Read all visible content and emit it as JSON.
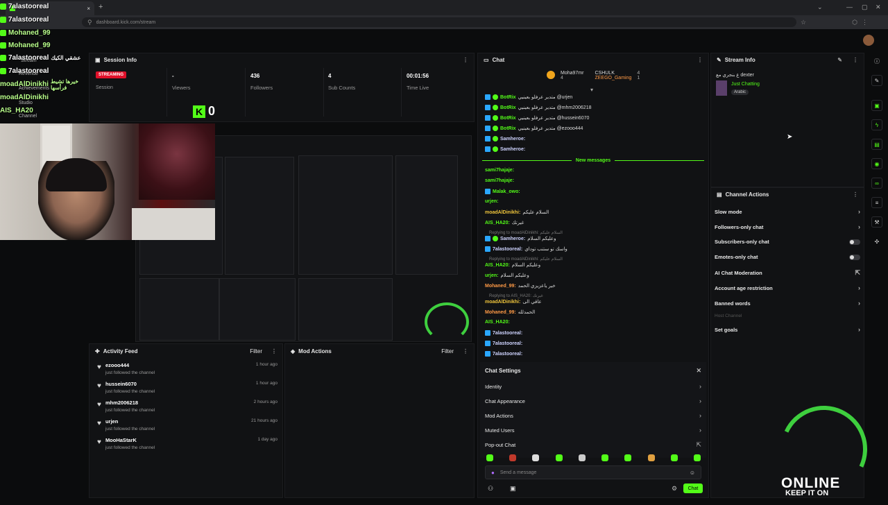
{
  "browser": {
    "url": "dashboard.kick.com/stream",
    "tab_close": "×",
    "new_tab": "+"
  },
  "overlay_chat": [
    {
      "name": "7alastooreal",
      "text": ""
    },
    {
      "name": "7alastooreal",
      "text": ""
    },
    {
      "name": "Mohaned_99",
      "text": ""
    },
    {
      "name": "Mohaned_99",
      "text": ""
    },
    {
      "name": "7alastooreal",
      "text": "عشقي الكيك"
    },
    {
      "name": "7alastooreal",
      "text": ""
    },
    {
      "name": "moadAlDinikhi",
      "text": "خيرها تشيط فرأسها"
    },
    {
      "name": "moadAlDinikhi",
      "text": ""
    },
    {
      "name": "AIS_HA20",
      "text": ""
    }
  ],
  "overlay_labels": [
    "Stream",
    "Revenue",
    "Achievements",
    "Studio",
    "Channel"
  ],
  "session": {
    "title": "Session Info",
    "badge": "STREAMING",
    "session_label": "Session",
    "stats": [
      {
        "value": "-",
        "label": "Viewers"
      },
      {
        "value": "436",
        "label": "Followers"
      },
      {
        "value": "4",
        "label": "Sub Counts"
      },
      {
        "value": "00:01:56",
        "label": "Time Live"
      }
    ],
    "kick_count": "0"
  },
  "activity": {
    "title": "Activity Feed",
    "filter": "Filter",
    "items": [
      {
        "name": "ezooo444",
        "sub": "just followed the channel",
        "time": "1 hour ago"
      },
      {
        "name": "hussein6070",
        "sub": "just followed the channel",
        "time": "1 hour ago"
      },
      {
        "name": "mhm2006218",
        "sub": "just followed the channel",
        "time": "2 hours ago"
      },
      {
        "name": "urjen",
        "sub": "just followed the channel",
        "time": "21 hours ago"
      },
      {
        "name": "MooHaStarK",
        "sub": "just followed the channel",
        "time": "1 day ago"
      }
    ]
  },
  "mod_actions": {
    "title": "Mod Actions",
    "filter": "Filter"
  },
  "chat": {
    "title": "Chat",
    "top_gifters": [
      {
        "name": "Moha97mr",
        "count": "4"
      },
      {
        "name": "CSHULK",
        "count": "4"
      },
      {
        "name": "ZEEGO_Gaming",
        "count": "1"
      }
    ],
    "new_messages": "New messages",
    "messages": [
      {
        "user": "BotRix",
        "text": "متدير عرفلو بعينيي @urjen",
        "cls": ""
      },
      {
        "user": "BotRix",
        "text": "متدير عرفلو بعينيي @mhm2006218",
        "cls": ""
      },
      {
        "user": "BotRix",
        "text": "متدير عرفلو بعينيي @hussein6070",
        "cls": ""
      },
      {
        "user": "BotRix",
        "text": "متدير عرفلو بعينيي @ezooo444",
        "cls": ""
      },
      {
        "user": "Samheroe:",
        "text": "",
        "cls": "w"
      },
      {
        "user": "Samheroe:",
        "text": "",
        "cls": "w"
      },
      {
        "user": "sami7hajaje:",
        "text": "",
        "cls": ""
      },
      {
        "user": "sami7hajaje:",
        "text": "",
        "cls": ""
      },
      {
        "user": "Malak_owo:",
        "text": "",
        "cls": ""
      },
      {
        "user": "urjen:",
        "text": "",
        "cls": ""
      },
      {
        "user": "moadAlDinikhi:",
        "text": "السلام عليكم",
        "cls": "y"
      },
      {
        "user": "AIS_HA20:",
        "text": "غيرتك",
        "cls": ""
      },
      {
        "user": "Samheroe:",
        "text": "وعليكم السلام",
        "cls": "w"
      },
      {
        "user": "7alastooreal:",
        "text": "واسك تو ستنب توداي",
        "cls": "w"
      },
      {
        "user": "AIS_HA20:",
        "text": "وعليكم السلام",
        "cls": ""
      },
      {
        "user": "urjen:",
        "text": "وعليكم السلام",
        "cls": ""
      },
      {
        "user": "Mohaned_99:",
        "text": "خير ياعزيزي الحمد",
        "cls": "o"
      },
      {
        "user": "moadAlDinikhi:",
        "text": "عاقي الى",
        "cls": "y"
      },
      {
        "user": "Mohaned_99:",
        "text": "الحمدلله",
        "cls": "o"
      },
      {
        "user": "AIS_HA20:",
        "text": "",
        "cls": ""
      },
      {
        "user": "7alastooreal:",
        "text": "",
        "cls": "w"
      },
      {
        "user": "7alastooreal:",
        "text": "",
        "cls": "w"
      },
      {
        "user": "7alastooreal:",
        "text": "",
        "cls": "w"
      }
    ],
    "replies": [
      "Replying to moadAlDinikhi: السلام عليكم",
      "Replying to moadAlDinikhi: السلام عليكم",
      "Replying to AIS_HA20: غيرتك"
    ],
    "settings": {
      "title": "Chat Settings",
      "items": [
        "Identity",
        "Chat Appearance",
        "Mod Actions",
        "Muted Users",
        "Pop-out Chat"
      ]
    },
    "input_placeholder": "Send a message",
    "send_label": "Chat"
  },
  "stream_info": {
    "title": "Stream Info",
    "stream_title": "ع بنجري مع dexter",
    "category": "Just Chatting",
    "language": "Arabic"
  },
  "channel_actions": {
    "title": "Channel Actions",
    "items": [
      {
        "label": "Slow mode",
        "kind": "chevron"
      },
      {
        "label": "Followers-only chat",
        "kind": "chevron"
      },
      {
        "label": "Subscribers-only chat",
        "kind": "toggle"
      },
      {
        "label": "Emotes-only chat",
        "kind": "toggle"
      },
      {
        "label": "AI Chat Moderation",
        "kind": "external"
      },
      {
        "label": "Account age restriction",
        "kind": "chevron"
      },
      {
        "label": "Banned words",
        "kind": "chevron"
      },
      {
        "label": "Host Channel",
        "kind": "disabled"
      },
      {
        "label": "Set goals",
        "kind": "chevron"
      }
    ]
  },
  "logo": {
    "line1": "ONLINE",
    "line2": "KEEP IT ON"
  },
  "colors": {
    "accent": "#53fc18",
    "live": "#e0102a",
    "panel": "#111214"
  }
}
